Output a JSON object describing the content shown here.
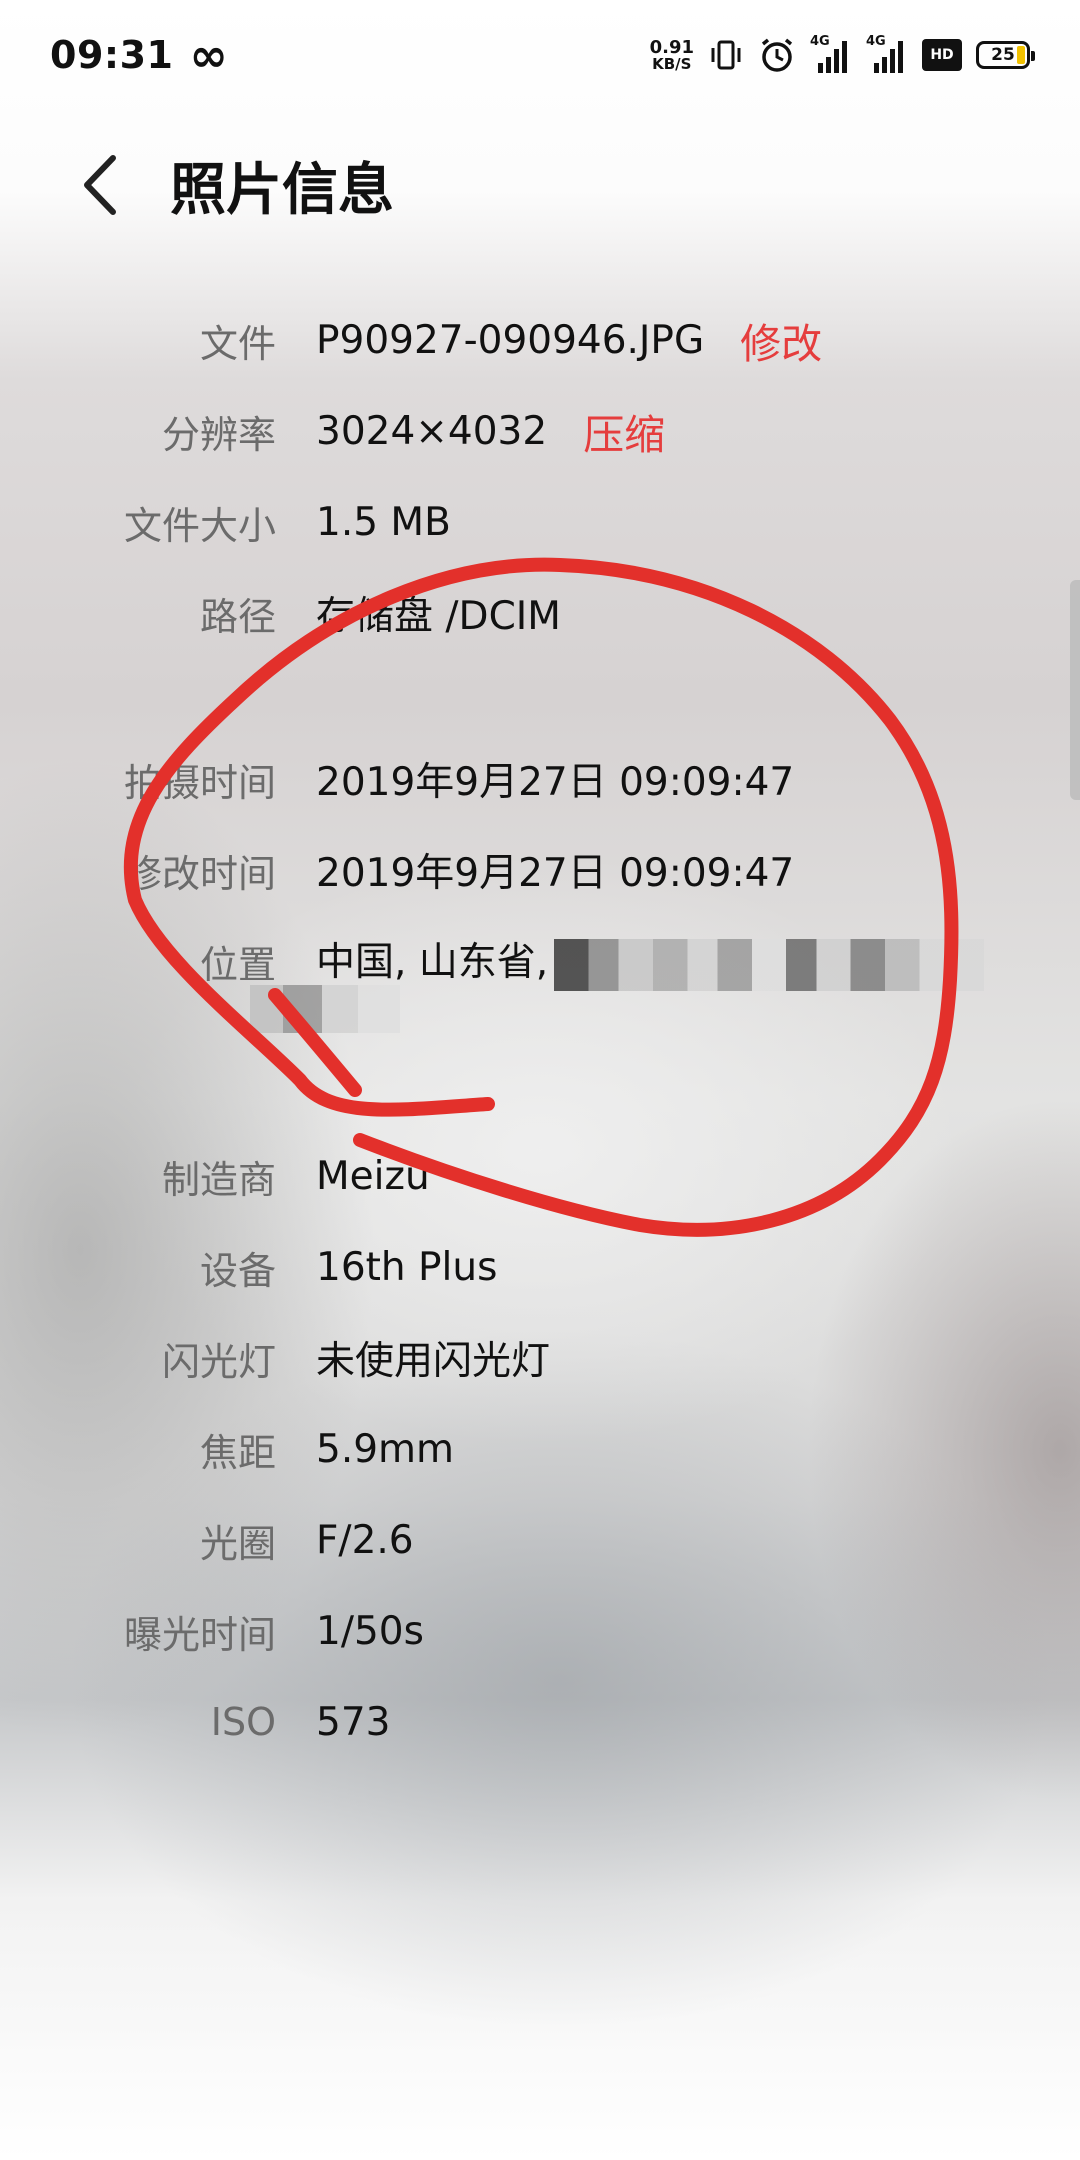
{
  "status_bar": {
    "time": "09:31",
    "net_speed_value": "0.91",
    "net_speed_unit": "KB/S",
    "signal_tag_1": "4G",
    "signal_tag_2": "4G",
    "hd_label": "HD",
    "battery_level": "25",
    "icons": [
      "infinity-icon",
      "vibrate-icon",
      "alarm-icon",
      "signal-icon",
      "signal-icon",
      "hd-icon",
      "battery-icon"
    ]
  },
  "header": {
    "title": "照片信息",
    "back_icon": "chevron-left-icon"
  },
  "info": {
    "file": {
      "label": "文件",
      "value": "P90927-090946.JPG",
      "action": "修改"
    },
    "resolution": {
      "label": "分辨率",
      "value": "3024×4032",
      "action": "压缩"
    },
    "file_size": {
      "label": "文件大小",
      "value": "1.5 MB"
    },
    "path": {
      "label": "路径",
      "value": "存储盘 /DCIM"
    },
    "capture_time": {
      "label": "拍摄时间",
      "value": "2019年9月27日 09:09:47"
    },
    "modified_time": {
      "label": "修改时间",
      "value": "2019年9月27日 09:09:47"
    },
    "location": {
      "label": "位置",
      "value": "中国, 山东省,"
    },
    "manufacturer": {
      "label": "制造商",
      "value": "Meizu"
    },
    "device": {
      "label": "设备",
      "value": "16th Plus"
    },
    "flash": {
      "label": "闪光灯",
      "value": "未使用闪光灯"
    },
    "focal_length": {
      "label": "焦距",
      "value": "5.9mm"
    },
    "aperture": {
      "label": "光圈",
      "value": "F/2.6"
    },
    "exposure_time": {
      "label": "曝光时间",
      "value": "1/50s"
    },
    "iso": {
      "label": "ISO",
      "value": "573"
    }
  },
  "colors": {
    "accent_red": "#e53d3d",
    "annotation_red": "#e3302b",
    "label_gray": "#6b6b6b",
    "text_dark": "#111111"
  }
}
